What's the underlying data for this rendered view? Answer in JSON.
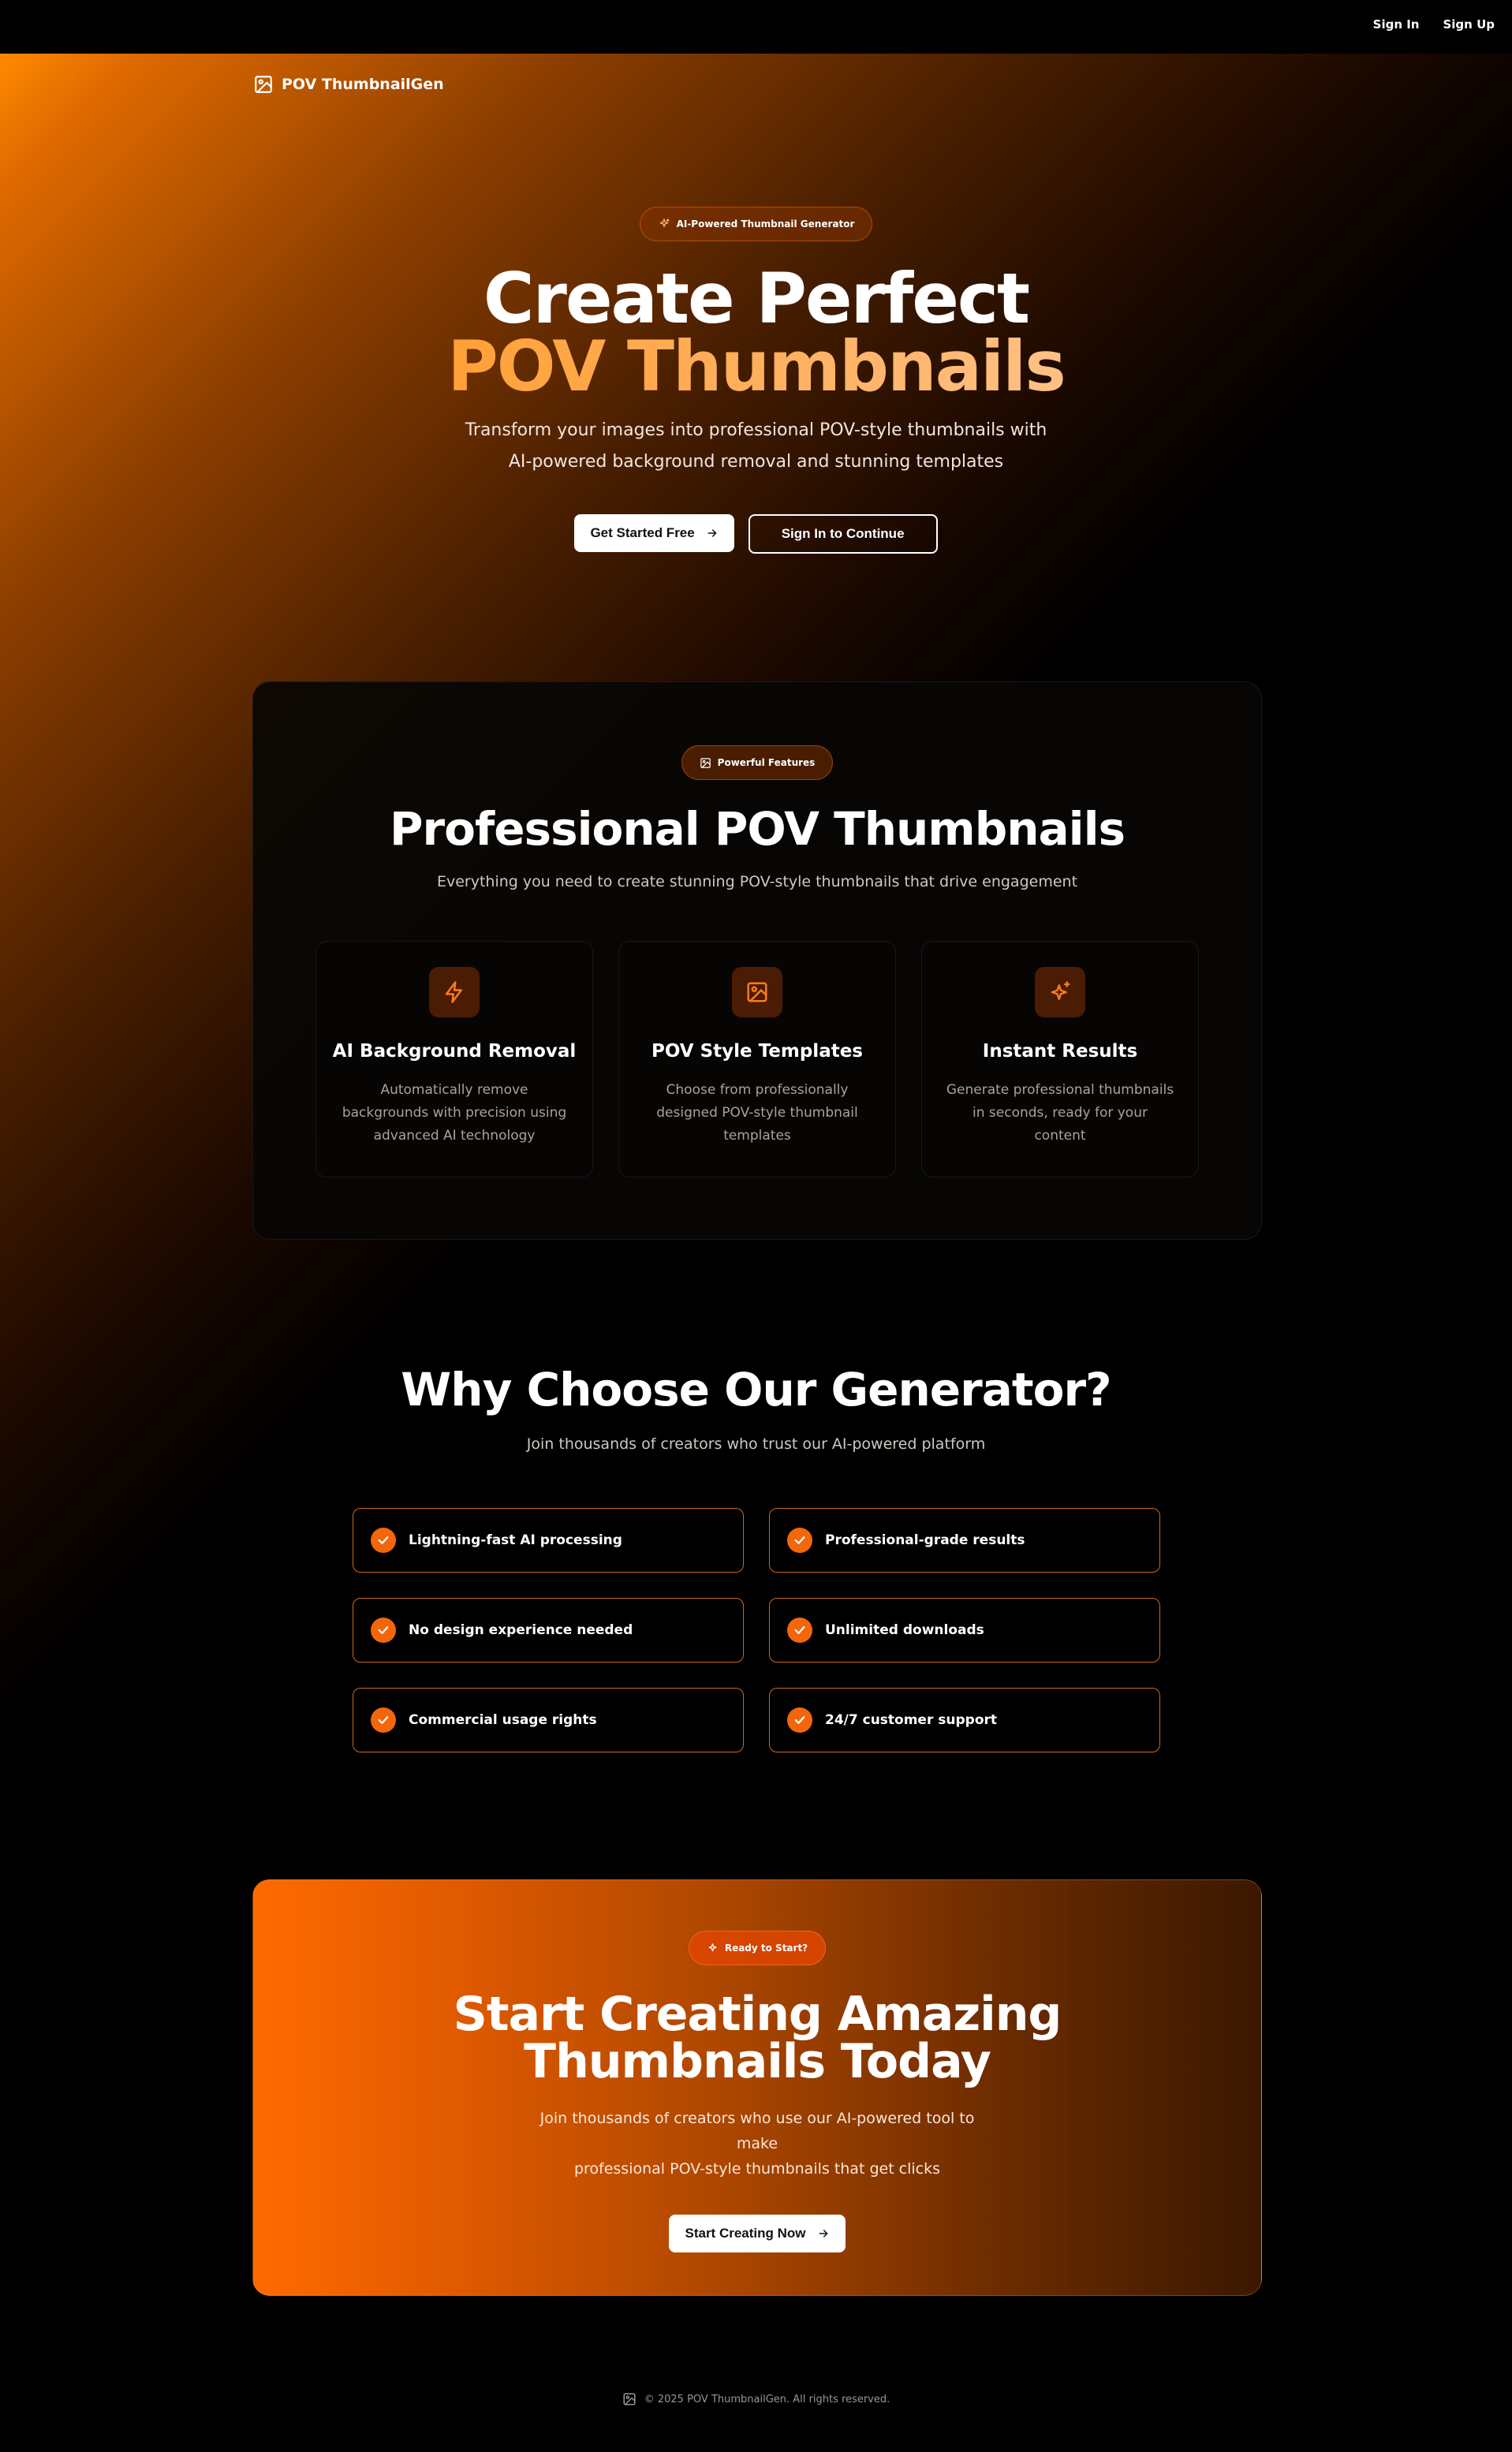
{
  "nav": {
    "sign_in": "Sign In",
    "sign_up": "Sign Up"
  },
  "brand": {
    "name": "POV ThumbnailGen",
    "icon": "image-icon"
  },
  "hero": {
    "badge": "AI-Powered Thumbnail Generator",
    "badge_icon": "sparkles-icon",
    "title_line1": "Create Perfect",
    "title_line2": "POV Thumbnails",
    "subtitle_line1": "Transform your images into professional POV-style thumbnails with",
    "subtitle_line2": "AI-powered background removal and stunning templates",
    "primary_cta": "Get Started Free",
    "secondary_cta": "Sign In to Continue"
  },
  "features": {
    "badge": "Powerful Features",
    "badge_icon": "image-icon",
    "title": "Professional POV Thumbnails",
    "subtitle": "Everything you need to create stunning POV-style thumbnails that drive engagement",
    "cards": [
      {
        "icon": "zap-icon",
        "title": "AI Background Removal",
        "description": "Automatically remove backgrounds with precision using advanced AI technology"
      },
      {
        "icon": "image-icon",
        "title": "POV Style Templates",
        "description": "Choose from professionally designed POV-style thumbnail templates"
      },
      {
        "icon": "sparkles-icon",
        "title": "Instant Results",
        "description": "Generate professional thumbnails in seconds, ready for your content"
      }
    ]
  },
  "why": {
    "title": "Why Choose Our Generator?",
    "subtitle": "Join thousands of creators who trust our AI-powered platform",
    "benefits": [
      "Lightning-fast AI processing",
      "Professional-grade results",
      "No design experience needed",
      "Unlimited downloads",
      "Commercial usage rights",
      "24/7 customer support"
    ]
  },
  "cta": {
    "badge": "Ready to Start?",
    "badge_icon": "sparkle-icon",
    "title_line1": "Start Creating Amazing",
    "title_line2": "Thumbnails Today",
    "text_line1": "Join thousands of creators who use our AI-powered tool to make",
    "text_line2": "professional POV-style thumbnails that get clicks",
    "button": "Start Creating Now"
  },
  "footer": {
    "text": "© 2025 POV ThumbnailGen. All rights reserved."
  },
  "colors": {
    "accent": "#f2670c",
    "accent_light": "#ffb770",
    "background": "#000000"
  }
}
